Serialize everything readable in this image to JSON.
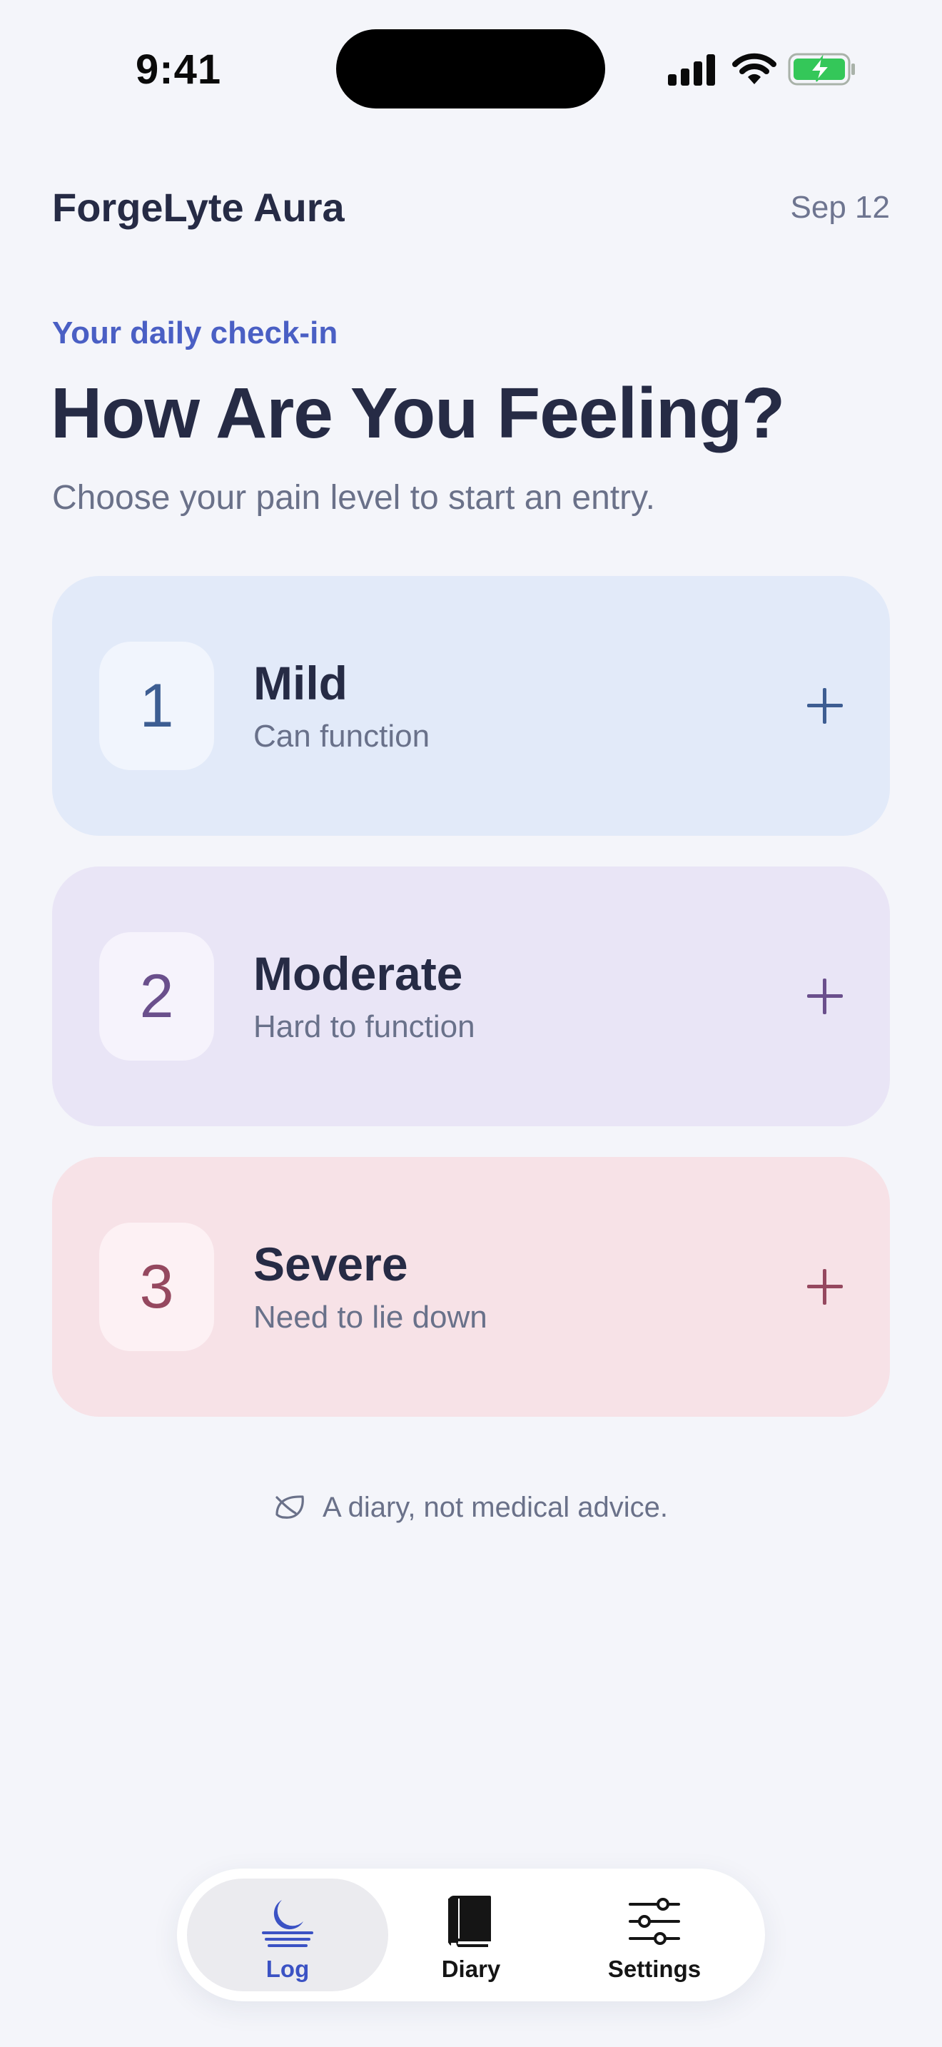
{
  "status_bar": {
    "time": "9:41",
    "icons": [
      "signal-icon",
      "wifi-icon",
      "battery-charging-icon"
    ],
    "battery_color": "#34c759"
  },
  "header": {
    "app_name": "ForgeLyte Aura",
    "date": "Sep 12"
  },
  "intro": {
    "eyebrow": "Your daily check-in",
    "title": "How Are You Feeling?",
    "subtitle": "Choose your pain level to start an entry."
  },
  "pain_levels": [
    {
      "number": "1",
      "name": "Mild",
      "description": "Can function",
      "color": "#e2eaf9",
      "accent": "#3d5d92",
      "icon": "plus-icon"
    },
    {
      "number": "2",
      "name": "Moderate",
      "description": "Hard to function",
      "color": "#e9e5f6",
      "accent": "#6a4f8c",
      "icon": "plus-icon"
    },
    {
      "number": "3",
      "name": "Severe",
      "description": "Need to lie down",
      "color": "#f7e2e7",
      "accent": "#95485f",
      "icon": "plus-icon"
    }
  ],
  "disclaimer": {
    "icon": "leaf-icon",
    "text": "A diary, not medical advice."
  },
  "tab_bar": {
    "tabs": [
      {
        "label": "Log",
        "icon": "moon-icon",
        "active": true
      },
      {
        "label": "Diary",
        "icon": "book-icon",
        "active": false
      },
      {
        "label": "Settings",
        "icon": "sliders-icon",
        "active": false
      }
    ],
    "accent": "#3b52c4"
  }
}
